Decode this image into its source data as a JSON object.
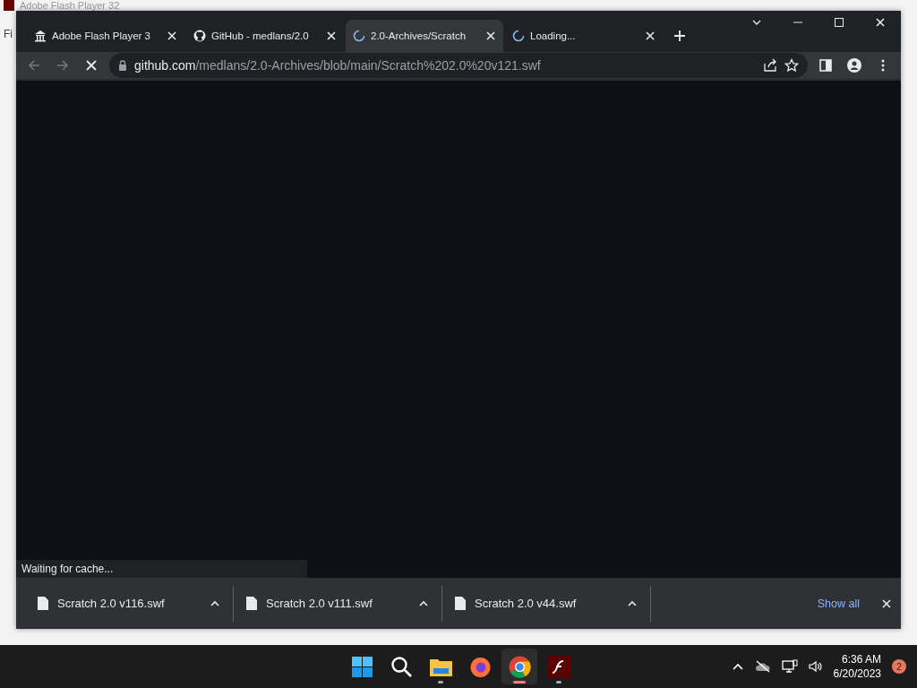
{
  "background_window": {
    "title": "Adobe Flash Player 32",
    "menu": [
      "Fi"
    ]
  },
  "browser": {
    "loading": true,
    "tabs": [
      {
        "title": "Adobe Flash Player 3",
        "kind": "museum",
        "selected": false
      },
      {
        "title": "GitHub - medlans/2.0",
        "kind": "github",
        "selected": false
      },
      {
        "title": "2.0-Archives/Scratch",
        "kind": "spinner",
        "selected": true
      },
      {
        "title": "Loading...",
        "kind": "spinner",
        "selected": false
      }
    ],
    "url": {
      "domain": "github.com",
      "path": "/medlans/2.0-Archives/blob/main/Scratch%202.0%20v121.swf"
    },
    "status": "Waiting for cache...",
    "downloads": [
      {
        "file": "Scratch 2.0 v116.swf"
      },
      {
        "file": "Scratch 2.0 v111.swf"
      },
      {
        "file": "Scratch 2.0 v44.swf"
      }
    ],
    "show_all": "Show all"
  },
  "taskbar": {
    "apps": [
      {
        "kind": "start",
        "active": false,
        "running": false
      },
      {
        "kind": "search",
        "active": false,
        "running": false
      },
      {
        "kind": "folder",
        "active": false,
        "running": true
      },
      {
        "kind": "firefox",
        "active": false,
        "running": false
      },
      {
        "kind": "chrome",
        "active": true,
        "running": true
      },
      {
        "kind": "flash",
        "active": false,
        "running": true
      }
    ],
    "time": "6:36 AM",
    "date": "6/20/2023",
    "notifications": "2"
  }
}
